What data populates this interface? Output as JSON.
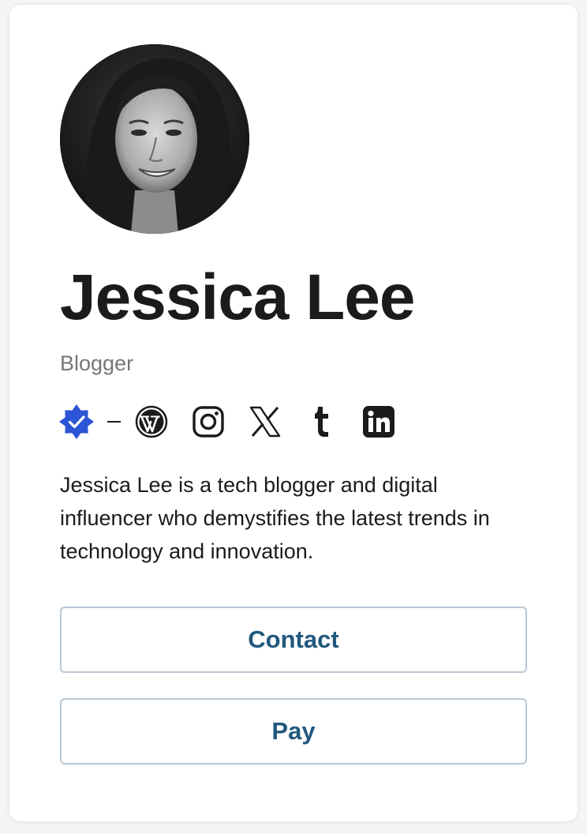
{
  "profile": {
    "name": "Jessica Lee",
    "role": "Blogger",
    "bio": "Jessica Lee is a tech blogger and digital influencer who demystifies the latest trends in technology and innovation."
  },
  "socials": [
    {
      "icon": "wordpress-icon"
    },
    {
      "icon": "instagram-icon"
    },
    {
      "icon": "x-icon"
    },
    {
      "icon": "tumblr-icon"
    },
    {
      "icon": "linkedin-icon"
    }
  ],
  "badge": {
    "icon": "verified-badge-icon",
    "color": "#2c55d6"
  },
  "actions": {
    "contact_label": "Contact",
    "pay_label": "Pay"
  },
  "colors": {
    "button_text": "#20587e",
    "button_border": "#b9c7d4",
    "role_text": "#767676"
  }
}
